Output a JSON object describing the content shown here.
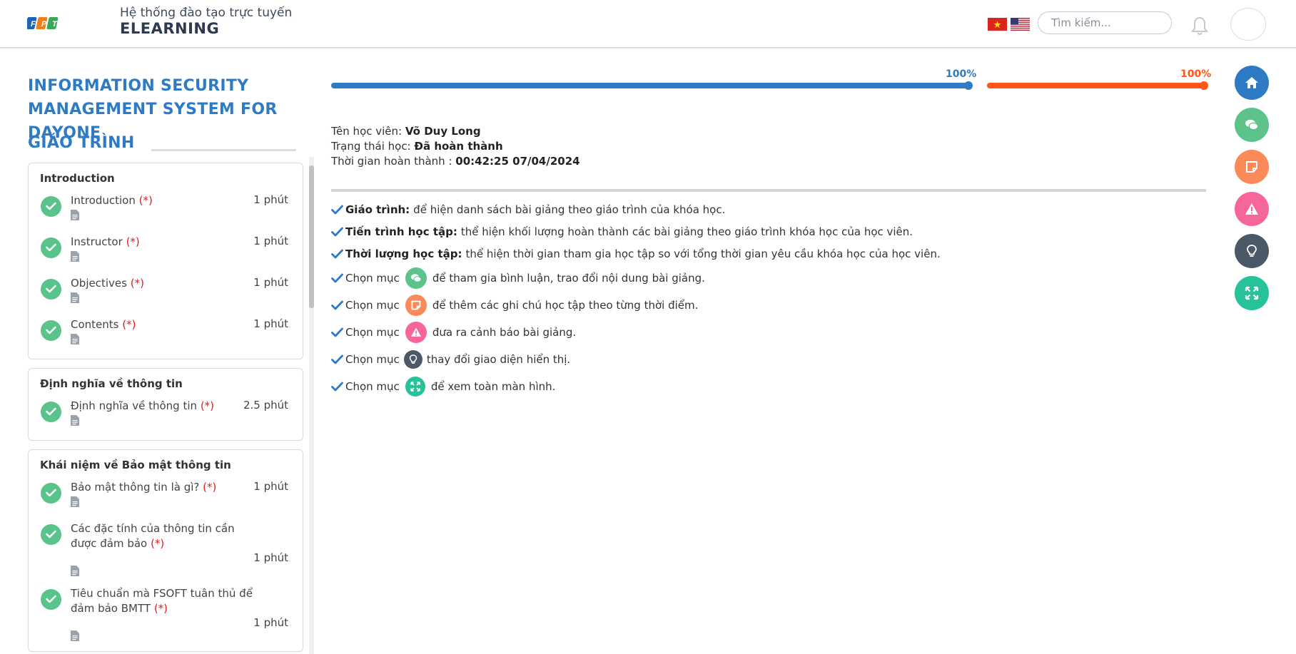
{
  "header": {
    "logo_text": "FPT",
    "subtitle": "Hệ thống đào tạo trực tuyến",
    "title": "ELEARNING",
    "search_placeholder": "Tìm kiếm...",
    "flags": [
      "vn-flag",
      "us-flag"
    ]
  },
  "course": {
    "title": "INFORMATION SECURITY MANAGEMENT SYSTEM FOR DAYONE",
    "curriculum_heading": "GIÁO TRÌNH"
  },
  "sections": [
    {
      "title": "Introduction",
      "lessons": [
        {
          "name": "Introduction",
          "required": "(*)",
          "duration": "1 phút"
        },
        {
          "name": "Instructor",
          "required": "(*)",
          "duration": "1 phút"
        },
        {
          "name": "Objectives",
          "required": "(*)",
          "duration": "1 phút"
        },
        {
          "name": "Contents",
          "required": "(*)",
          "duration": "1 phút"
        }
      ]
    },
    {
      "title": "Định nghĩa về thông tin",
      "lessons": [
        {
          "name": "Định nghĩa về thông tin",
          "required": "(*)",
          "duration": "2.5 phút"
        }
      ]
    },
    {
      "title": "Khái niệm về Bảo mật thông tin",
      "lessons": [
        {
          "name": "Bảo mật thông tin là gì?",
          "required": "(*)",
          "duration": "1 phút"
        },
        {
          "name": "Các đặc tính của thông tin cần được đảm bảo",
          "required": "(*)",
          "duration": "1 phút"
        },
        {
          "name": "Tiêu chuẩn mà FSOFT tuân thủ để đảm bảo BMTT",
          "required": "(*)",
          "duration": "1 phút"
        }
      ]
    }
  ],
  "progress": {
    "curriculum_pct": "100%",
    "curriculum_value": 1.0,
    "time_pct": "100%",
    "time_value": 1.0,
    "colors": {
      "curriculum": "#2e7ac4",
      "time": "#ff5518"
    }
  },
  "student": {
    "name_label": "Tên học viên:",
    "name": "Võ Duy Long",
    "status_label": "Trạng thái học:",
    "status": "Đã hoàn thành",
    "completed_label": "Thời gian hoàn thành :",
    "completed": "00:42:25 07/04/2024"
  },
  "guide": {
    "rows": [
      {
        "bold": "Giáo trình:",
        "text": "để hiện danh sách bài giảng theo giáo trình của khóa học."
      },
      {
        "bold": "Tiến trình học tập:",
        "text": "thể hiện khối lượng hoàn thành các bài giảng theo giáo trình khóa học của học viên."
      },
      {
        "bold": "Thời lượng học tập:",
        "text": "thể hiện thời gian tham gia học tập so với tổng thời gian yêu cầu khóa học của học viên."
      }
    ],
    "choose_label": "Chọn mục",
    "icon_rows": [
      {
        "icon": "chat-icon",
        "text": "để tham gia bình luận, trao đổi nội dung bài giảng."
      },
      {
        "icon": "note-icon",
        "text": "để thêm các ghi chú học tập theo từng thời điểm."
      },
      {
        "icon": "warning-icon",
        "text": "đưa ra cảnh báo bài giảng."
      },
      {
        "icon": "bulb-icon",
        "text": "thay đổi giao diện hiển thị."
      },
      {
        "icon": "fullscreen-icon",
        "text": "để xem toàn màn hình."
      }
    ]
  },
  "fab_buttons": [
    {
      "icon": "home-icon",
      "color": "#2e7ac4"
    },
    {
      "icon": "chat-icon",
      "color": "#5cc48a"
    },
    {
      "icon": "note-icon",
      "color": "#fa8a5a"
    },
    {
      "icon": "warning-icon",
      "color": "#f6669a"
    },
    {
      "icon": "bulb-icon",
      "color": "#4b5867"
    },
    {
      "icon": "fullscreen-icon",
      "color": "#26c29a"
    }
  ]
}
